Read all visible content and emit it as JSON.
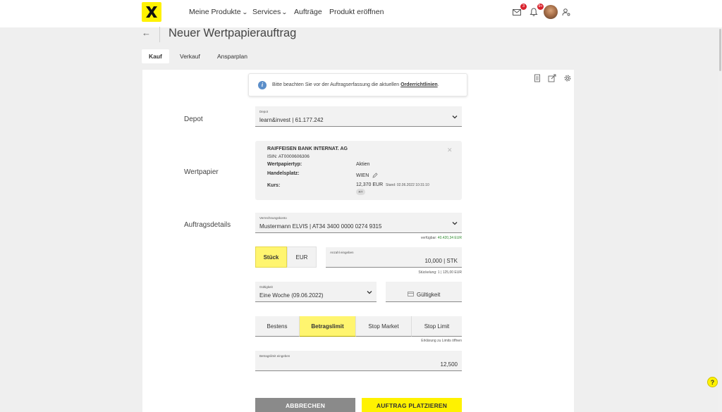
{
  "nav": {
    "items": [
      {
        "label": "Meine Produkte",
        "has_dropdown": true
      },
      {
        "label": "Services",
        "has_dropdown": true
      },
      {
        "label": "Aufträge",
        "has_dropdown": false
      },
      {
        "label": "Produkt eröffnen",
        "has_dropdown": false
      }
    ],
    "mail_badge": "3",
    "notification_badge": "9+",
    "icons": [
      "mail-icon",
      "bell-icon",
      "avatar",
      "user-settings-icon"
    ]
  },
  "header": {
    "title": "Neuer Wertpapierauftrag"
  },
  "tabs": [
    {
      "label": "Kauf",
      "active": true
    },
    {
      "label": "Verkauf",
      "active": false
    },
    {
      "label": "Ansparplan",
      "active": false
    }
  ],
  "info": {
    "text": "Bitte beachten Sie vor der Auftragserfassung die aktuellen ",
    "link": "Orderrichtlinien",
    "suffix": "."
  },
  "depot": {
    "section_label": "Depot",
    "field_label": "Depot",
    "value": "learn&invest | 61.177.242"
  },
  "security": {
    "section_label": "Wertpapier",
    "name": "RAIFFEISEN BANK INTERNAT. AG",
    "isin": "ISIN: AT0000606306",
    "type_label": "Wertpapiertyp:",
    "type_value": "Aktien",
    "venue_label": "Handelsplatz:",
    "venue_value": "WIEN",
    "price_label": "Kurs:",
    "price_value": "12,370 EUR",
    "price_stand": "Stand: 02.06.2022 10:31:10",
    "rt_badge": "RT"
  },
  "order": {
    "section_label": "Auftragsdetails",
    "account_label": "Verrechnungskonto",
    "account_value": "Mustermann ELVIS | AT34 3400 0000 0274 9315",
    "available_prefix": "verfügbar: ",
    "available_value": "40.420,34 EUR",
    "unit_toggle": [
      {
        "label": "Stück",
        "active": true
      },
      {
        "label": "EUR",
        "active": false
      }
    ],
    "quantity_label": "Anzahl eingeben",
    "quantity_value": "10,000 | STK",
    "stueckelung": "Stückelung: 1 | 125,00 EUR",
    "validity_label": "Gültigkeit",
    "validity_value": "Eine Woche (09.06.2022)",
    "validity_date_button": "Gültigkeit",
    "order_types": [
      {
        "label": "Bestens",
        "active": false
      },
      {
        "label": "Betragslimit",
        "active": true
      },
      {
        "label": "Stop Market",
        "active": false
      },
      {
        "label": "Stop Limit",
        "active": false
      }
    ],
    "limit_help_link": "Erklärung zu Limits öffnen",
    "limit_label": "Betragslimit eingeben",
    "limit_value": "12,500"
  },
  "actions": {
    "cancel": "ABBRECHEN",
    "submit": "AUFTRAG PLATZIEREN"
  },
  "help": "?",
  "colors": {
    "brand_yellow": "#fff200",
    "toggle_yellow": "#fff56f",
    "cancel_grey": "#8a8a8a",
    "badge_red": "#d9232d",
    "available_green": "#2e8b2e"
  }
}
